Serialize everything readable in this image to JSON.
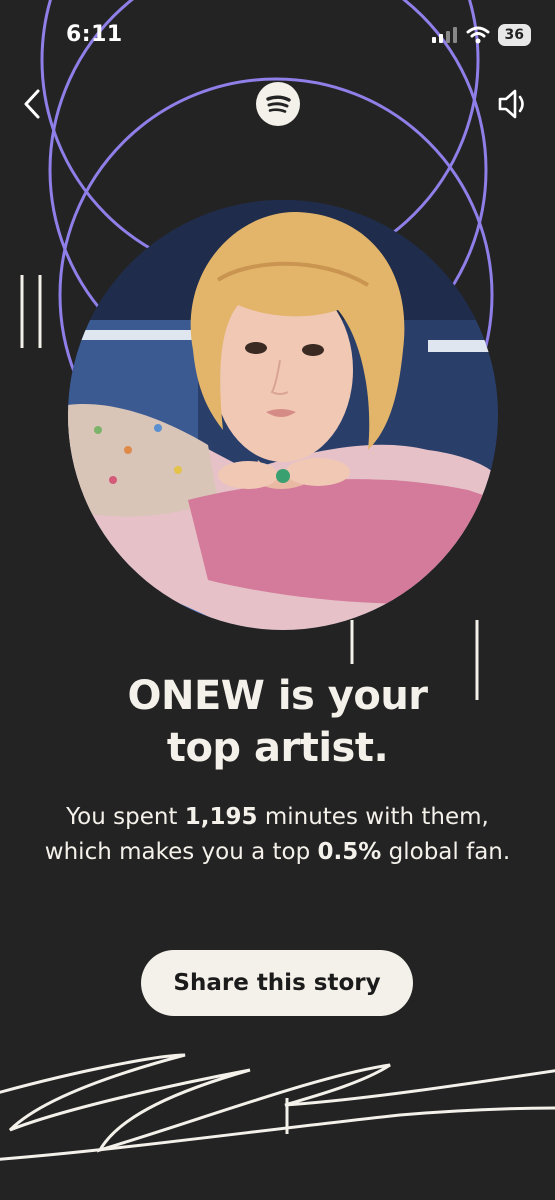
{
  "status_bar": {
    "time": "6:11",
    "battery": "36"
  },
  "nav": {
    "back_icon": "chevron-left-icon",
    "logo_icon": "spotify-logo-icon",
    "sound_icon": "speaker-icon"
  },
  "artist": {
    "name": "ONEW"
  },
  "headline": {
    "line1": "ONEW is your",
    "line2": "top artist."
  },
  "stats": {
    "prefix": "You spent ",
    "minutes": "1,195",
    "mid": " minutes with them, which makes you a top ",
    "percent": "0.5%",
    "suffix": " global fan."
  },
  "share_button": {
    "label": "Share this story"
  },
  "colors": {
    "background": "#232323",
    "accent": "#8f7fe8",
    "text": "#f4f0ea"
  }
}
